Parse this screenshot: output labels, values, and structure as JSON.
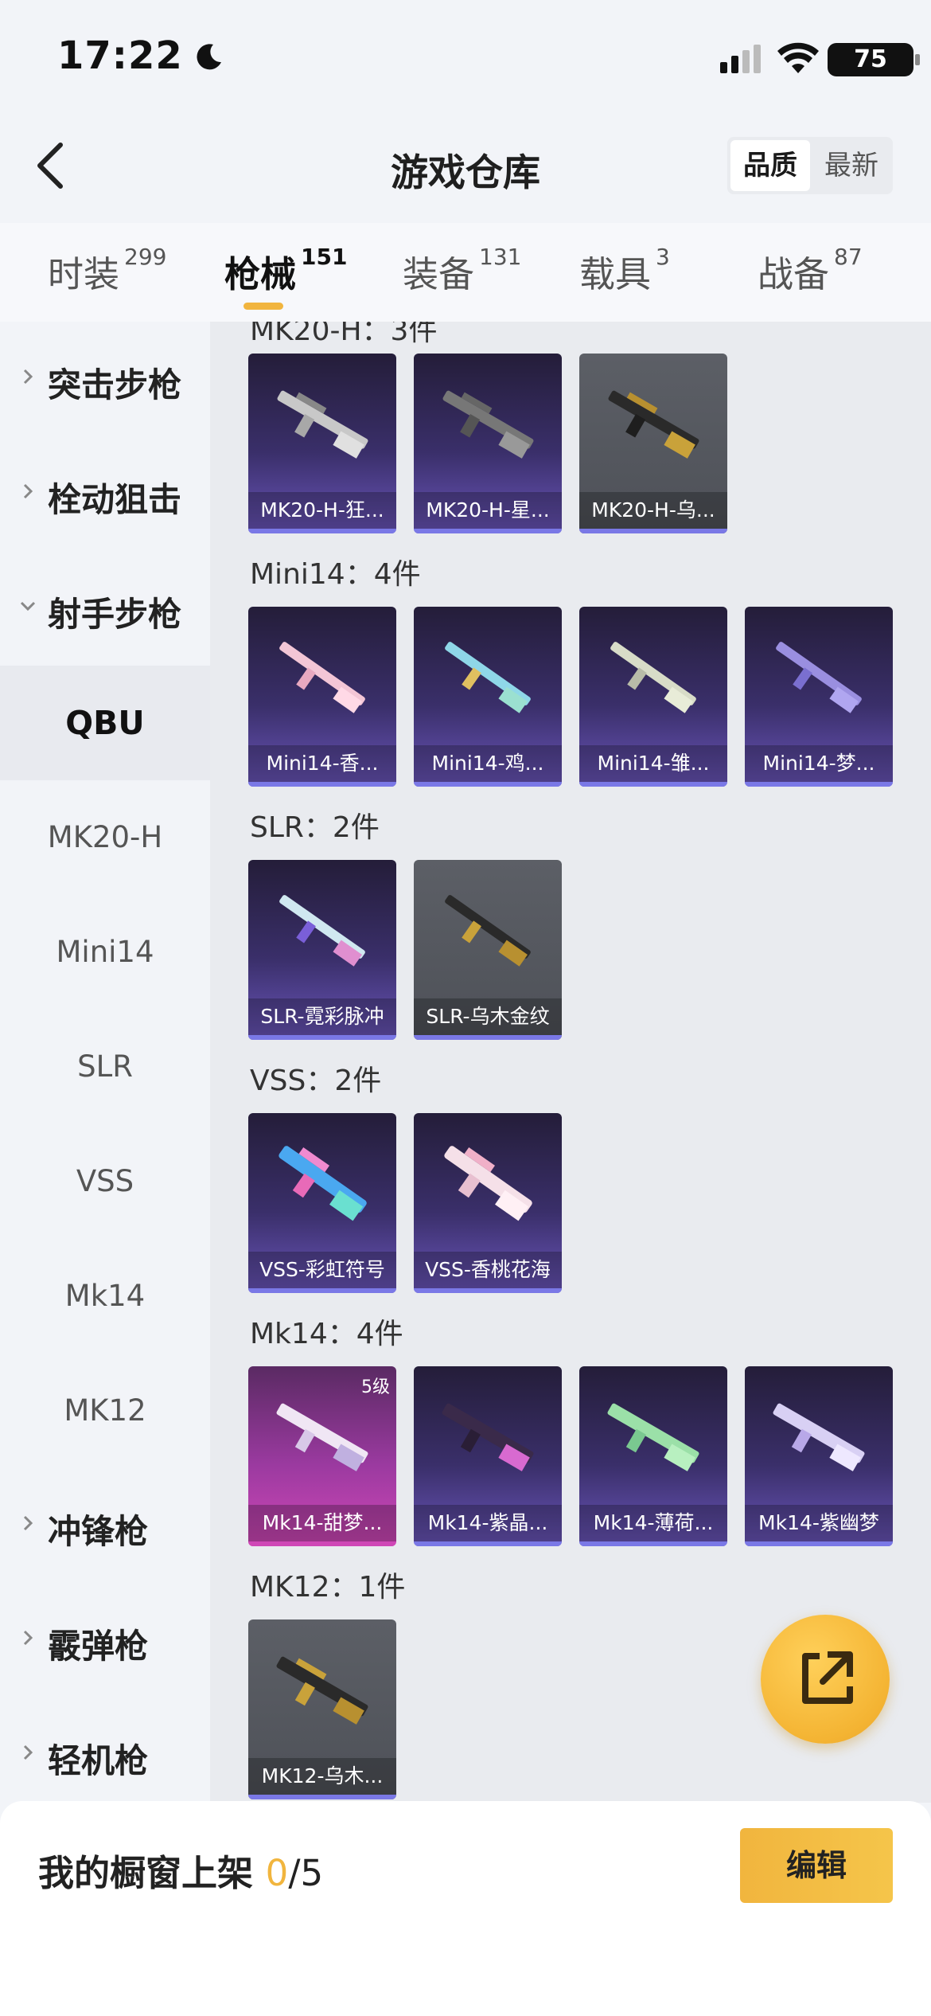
{
  "status": {
    "time": "17:22",
    "battery": "75"
  },
  "header": {
    "title": "游戏仓库",
    "sort_quality": "品质",
    "sort_newest": "最新"
  },
  "tabs": [
    {
      "label": "时装",
      "count": "299"
    },
    {
      "label": "枪械",
      "count": "151"
    },
    {
      "label": "装备",
      "count": "131"
    },
    {
      "label": "载具",
      "count": "3"
    },
    {
      "label": "战备",
      "count": "87"
    }
  ],
  "sidebar": {
    "categories": {
      "assault": "突击步枪",
      "bolt": "栓动狙击",
      "marksman": "射手步枪",
      "smg": "冲锋枪",
      "shotgun": "霰弹枪",
      "lmg": "轻机枪"
    },
    "subs": {
      "qbu": "QBU",
      "mk20h": "MK20-H",
      "mini14": "Mini14",
      "slr": "SLR",
      "vss": "VSS",
      "mk14": "Mk14",
      "mk12": "MK12"
    }
  },
  "sections": {
    "mk20h_partial": "MK20-H：3件",
    "mini14": "Mini14：4件",
    "slr": "SLR：2件",
    "vss": "VSS：2件",
    "mk14": "Mk14：4件",
    "mk12": "MK12：1件"
  },
  "items": {
    "mk20h": [
      "MK20-H-狂...",
      "MK20-H-星...",
      "MK20-H-乌..."
    ],
    "mini14": [
      "Mini14-香...",
      "Mini14-鸡...",
      "Mini14-雏...",
      "Mini14-梦..."
    ],
    "slr": [
      "SLR-霓彩脉冲",
      "SLR-乌木金纹"
    ],
    "vss": [
      "VSS-彩虹符号",
      "VSS-香桃花海"
    ],
    "mk14": [
      "Mk14-甜梦...",
      "Mk14-紫晶...",
      "Mk14-薄荷...",
      "Mk14-紫幽梦"
    ],
    "mk12": [
      "MK12-乌木..."
    ],
    "mk14_level_badge": "5级"
  },
  "footer": {
    "label": "我的橱窗上架 ",
    "count": "0",
    "total": "/5",
    "edit": "编辑"
  },
  "icons": [
    "moon-icon",
    "signal-icon",
    "wifi-icon",
    "battery-icon",
    "back-arrow-icon",
    "chevron-right-icon",
    "chevron-down-icon",
    "share-icon"
  ],
  "colors": {
    "accent": "#f1b53e",
    "rarity_purple": "#7a78e6",
    "rarity_pink": "#cf47b6"
  }
}
